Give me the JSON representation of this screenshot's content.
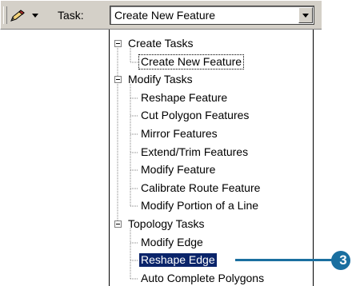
{
  "toolbar": {
    "task_label": "Task:",
    "task_value": "Create New Feature",
    "pencil_icon": "pencil-icon",
    "dropdown_icon": "chevron-down-icon"
  },
  "tree": {
    "groups": [
      {
        "label": "Create Tasks",
        "items": [
          "Create New Feature"
        ]
      },
      {
        "label": "Modify Tasks",
        "items": [
          "Reshape Feature",
          "Cut Polygon Features",
          "Mirror Features",
          "Extend/Trim Features",
          "Modify Feature",
          "Calibrate Route Feature",
          "Modify Portion of a Line"
        ]
      },
      {
        "label": "Topology Tasks",
        "items": [
          "Modify Edge",
          "Reshape Edge",
          "Auto Complete Polygons"
        ]
      }
    ],
    "focused_item": "Create New Feature",
    "selected_item": "Reshape Edge"
  },
  "callout": {
    "number": "3",
    "color": "#1a6fa0"
  },
  "colors": {
    "selection_bg": "#0a246a",
    "toolbar_bg": "#d4d0c8"
  }
}
